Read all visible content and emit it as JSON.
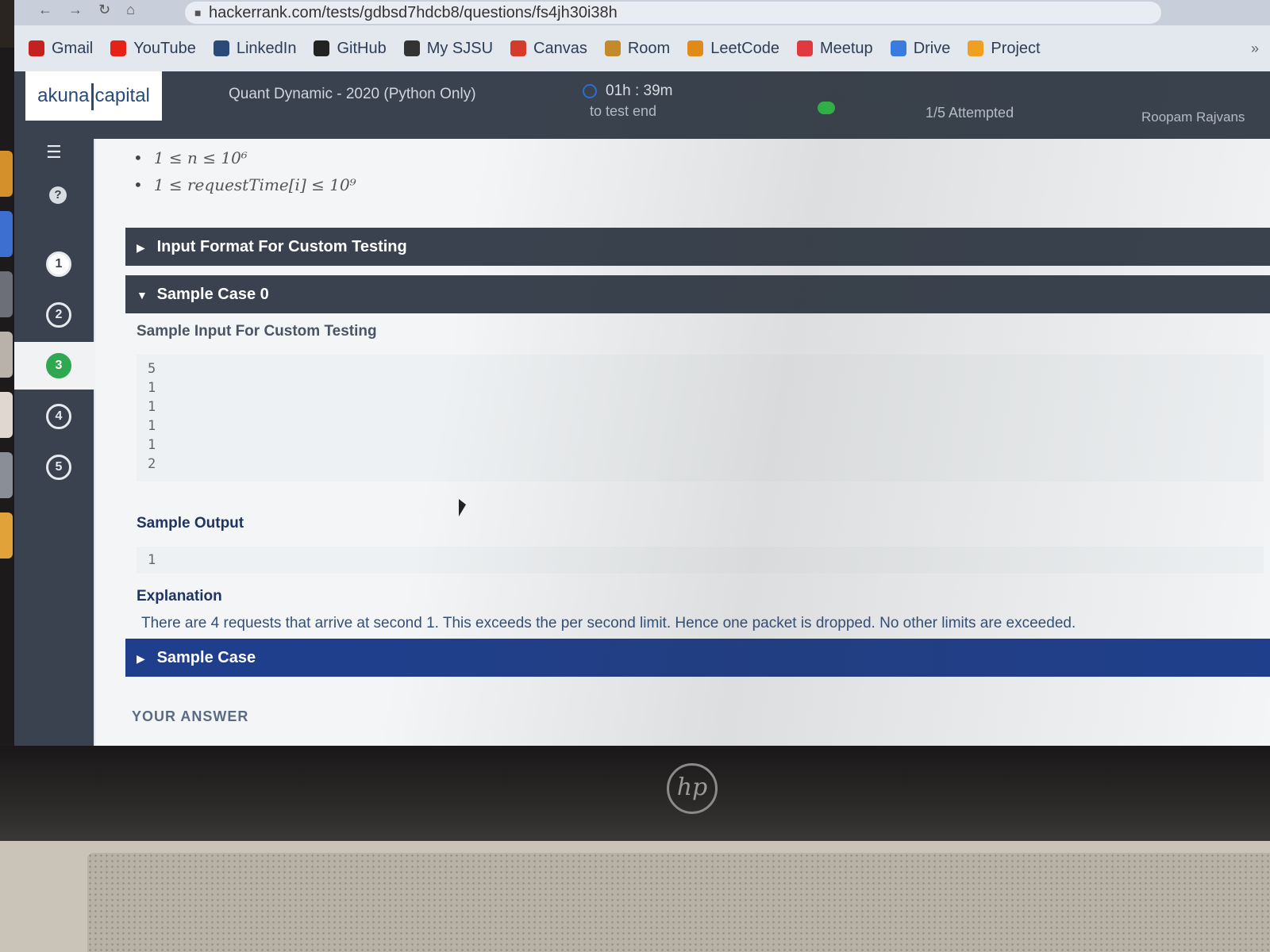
{
  "browser": {
    "url": "hackerrank.com/tests/gdbsd7hdcb8/questions/fs4jh30i38h",
    "bookmarks": [
      {
        "label": "Gmail",
        "icon": "gmail-icon",
        "color": "#c5221f"
      },
      {
        "label": "YouTube",
        "icon": "youtube-icon",
        "color": "#e62117"
      },
      {
        "label": "LinkedIn",
        "icon": "linkedin-icon",
        "color": "#2a4a7a"
      },
      {
        "label": "GitHub",
        "icon": "github-icon",
        "color": "#222222"
      },
      {
        "label": "My SJSU",
        "icon": "globe-icon",
        "color": "#333333"
      },
      {
        "label": "Canvas",
        "icon": "canvas-icon",
        "color": "#d63a2b"
      },
      {
        "label": "Room",
        "icon": "room-icon",
        "color": "#c28a2b"
      },
      {
        "label": "LeetCode",
        "icon": "leetcode-icon",
        "color": "#e08a1a"
      },
      {
        "label": "Meetup",
        "icon": "meetup-icon",
        "color": "#e0393e"
      },
      {
        "label": "Drive",
        "icon": "drive-icon",
        "color": "#3a7be0"
      },
      {
        "label": "Project",
        "icon": "drive-icon",
        "color": "#f0a020"
      }
    ],
    "more": "»"
  },
  "header": {
    "logo_left": "akuna",
    "logo_right": "capital",
    "test_name": "Quant Dynamic - 2020 (Python Only)",
    "timer": "01h : 39m",
    "timer_sub": "to test end",
    "attempted": "1/5 Attempted",
    "user": "Roopam Rajvans"
  },
  "rail": {
    "questions": [
      "1",
      "2",
      "3",
      "4",
      "5"
    ],
    "current": "3"
  },
  "problem": {
    "constraints": [
      "1 ≤ n ≤ 10⁶",
      "1 ≤ requestTime[i] ≤ 10⁹"
    ],
    "input_format_label": "Input Format For Custom Testing",
    "sample_case_0_label": "Sample Case 0",
    "sample_input_title": "Sample Input For Custom Testing",
    "sample_input_lines": [
      "5",
      "1",
      "1",
      "1",
      "1",
      "2"
    ],
    "sample_output_title": "Sample Output",
    "sample_output_lines": [
      "1"
    ],
    "explanation_title": "Explanation",
    "explanation_text": "There are 4 requests that arrive at second 1. This exceeds the per second limit. Hence one packet is dropped. No other  limits are exceeded.",
    "sample_case_1_label": "Sample Case",
    "your_answer": "YOUR ANSWER"
  },
  "device": {
    "brand": "hp"
  }
}
